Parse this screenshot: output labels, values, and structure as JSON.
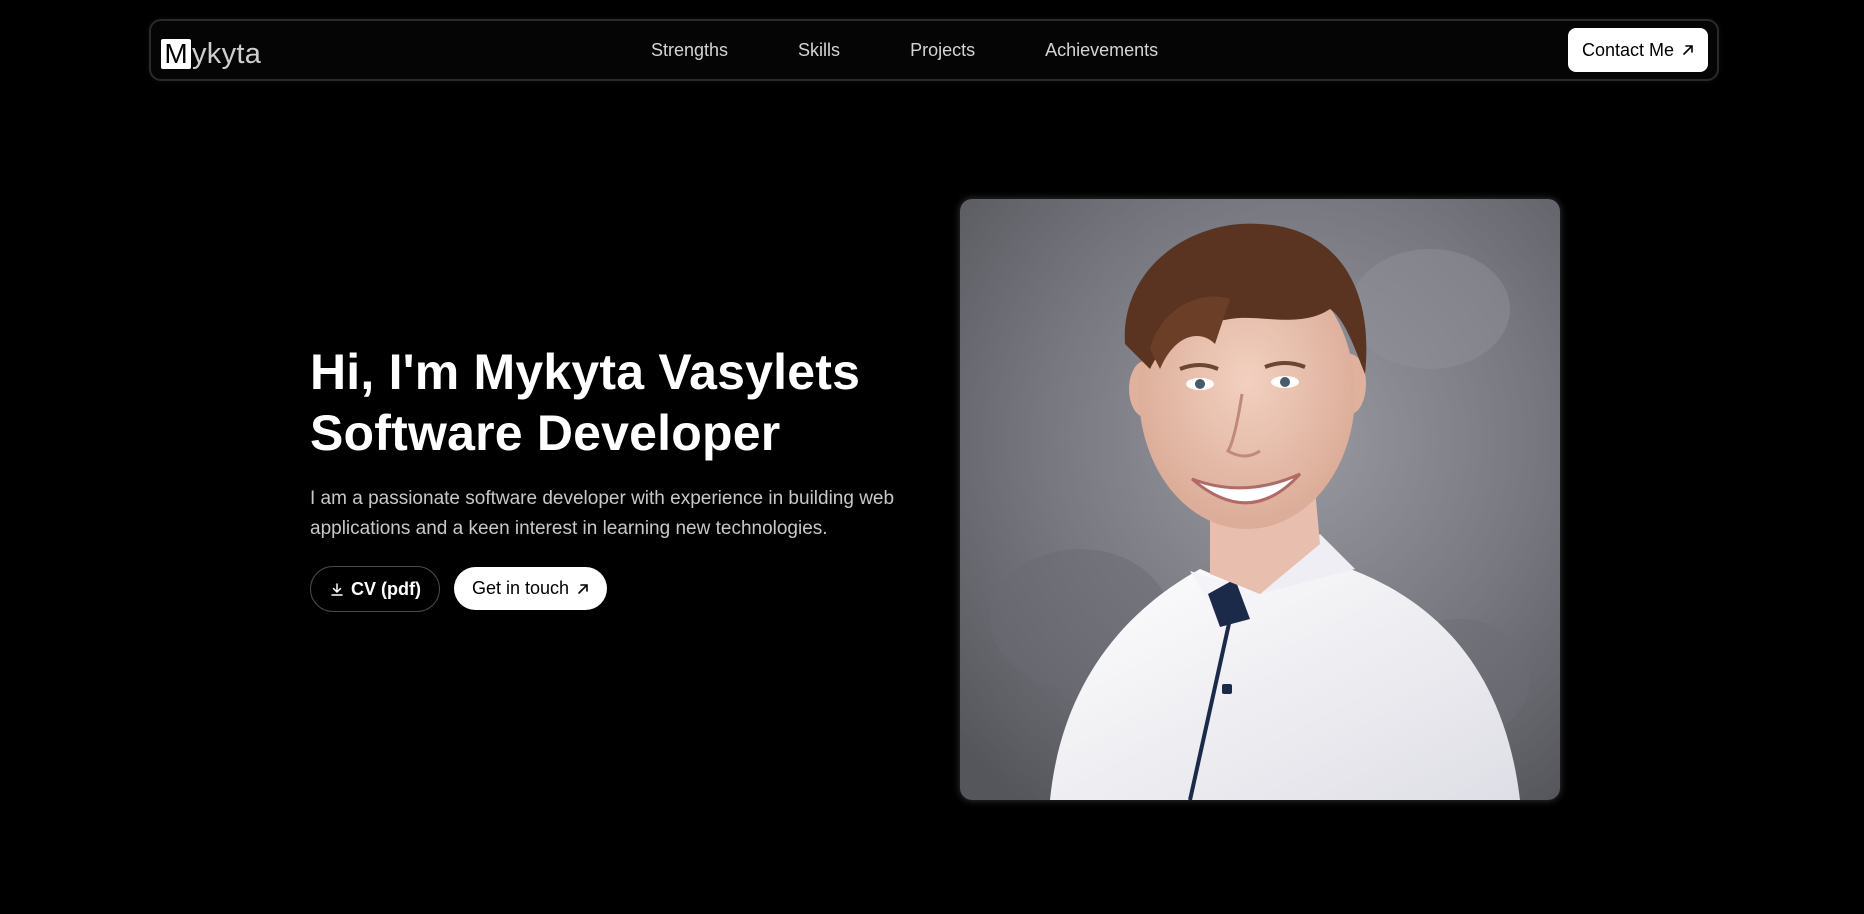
{
  "nav": {
    "logo_initial": "M",
    "logo_rest": "ykyta",
    "links": [
      "Strengths",
      "Skills",
      "Projects",
      "Achievements"
    ],
    "contact_label": "Contact Me"
  },
  "hero": {
    "title_line1": "Hi, I'm Mykyta Vasylets",
    "title_line2": "Software Developer",
    "description": "I am a passionate software developer with experience in building web applications and a keen interest in learning new technologies.",
    "cv_button": "CV (pdf)",
    "touch_button": "Get in touch"
  },
  "colors": {
    "background": "#000000",
    "text": "#ffffff",
    "muted_text": "#c8c8c8",
    "button_bg": "#ffffff"
  },
  "icons": {
    "download": "download-icon",
    "arrow": "arrow-up-right-icon"
  }
}
